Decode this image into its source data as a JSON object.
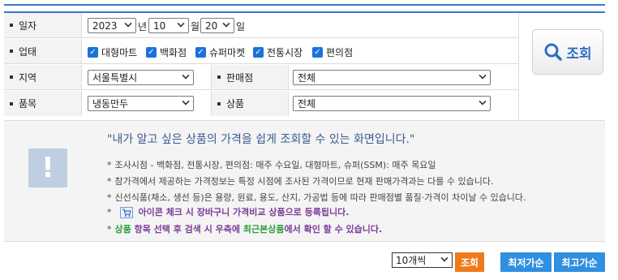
{
  "filters": {
    "date": {
      "label": "일자",
      "year": "2023",
      "year_unit": "년",
      "month": "10",
      "month_unit": "월",
      "day": "20",
      "day_unit": "일"
    },
    "business_type": {
      "label": "업태",
      "options": [
        {
          "label": "대형마트",
          "checked": true
        },
        {
          "label": "백화점",
          "checked": true
        },
        {
          "label": "슈퍼마켓",
          "checked": true
        },
        {
          "label": "전통시장",
          "checked": true
        },
        {
          "label": "편의점",
          "checked": true
        }
      ]
    },
    "region": {
      "label": "지역",
      "value": "서울특별시"
    },
    "store": {
      "label": "판매점",
      "value": "전체"
    },
    "item": {
      "label": "품목",
      "value": "냉동만두"
    },
    "product": {
      "label": "상품",
      "value": "전체"
    }
  },
  "search_button": {
    "label": "조회",
    "icon": "search-icon"
  },
  "info": {
    "icon": "exclamation-icon",
    "headline": "\"내가 알고 싶은 상품의 가격을 쉽게 조회할 수 있는 화면입니다.\"",
    "notes": [
      "조사시점 - 백화점, 전통시장, 편의점: 매주 수요일, 대형마트, 슈퍼(SSM): 매주 목요일",
      "참가격에서 제공하는 가격정보는 특정 시점에 조사된 가격이므로 현재 판매가격과는 다를 수 있습니다.",
      "신선식품(채소, 생선 등)은 용량, 원료, 용도, 산지, 가공법 등에 따라 판매점별 품질·가격이 차이날 수 있습니다."
    ],
    "cart_note": "아이콘 체크 시 장바구니 가격비교 상품으로 등록됩니다.",
    "product_note": {
      "p1": "상품",
      "p2": " 항목 선택 후 검색 시 우측에 ",
      "p3": "최근본상품",
      "p4": "에서 확인 할 수 있습니다."
    }
  },
  "bottom": {
    "per_page": "10개씩",
    "search": "조회",
    "lowest": "최저가순",
    "highest": "최고가순"
  },
  "colors": {
    "accent": "#3a78c9",
    "orange": "#f07a1a",
    "blue_button": "#2f8fe0",
    "purple": "#7d3c98",
    "green": "#2e9c3c"
  }
}
